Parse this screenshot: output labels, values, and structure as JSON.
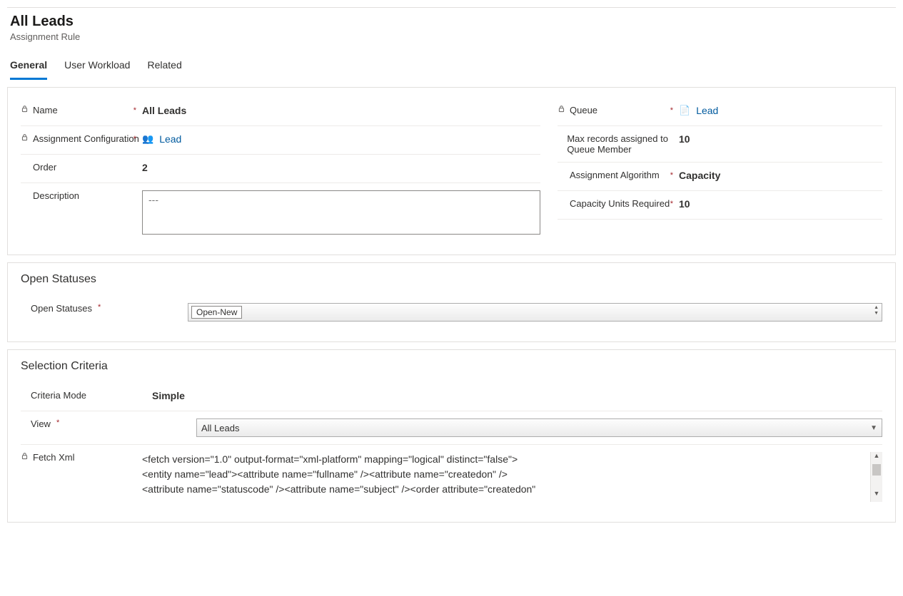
{
  "header": {
    "title": "All Leads",
    "subtitle": "Assignment Rule"
  },
  "tabs": {
    "general": "General",
    "user_workload": "User Workload",
    "related": "Related"
  },
  "left": {
    "name_label": "Name",
    "name_value": "All Leads",
    "ac_label": "Assignment Configuration",
    "ac_value": "Lead",
    "order_label": "Order",
    "order_value": "2",
    "desc_label": "Description",
    "desc_placeholder": "---"
  },
  "right": {
    "queue_label": "Queue",
    "queue_value": "Lead",
    "max_label": "Max records assigned to Queue Member",
    "max_value": "10",
    "algo_label": "Assignment Algorithm",
    "algo_value": "Capacity",
    "cap_label": "Capacity Units Required",
    "cap_value": "10"
  },
  "open_statuses": {
    "section_title": "Open Statuses",
    "label": "Open Statuses",
    "chip": "Open-New"
  },
  "selection": {
    "section_title": "Selection Criteria",
    "mode_label": "Criteria Mode",
    "mode_value": "Simple",
    "view_label": "View",
    "view_value": "All Leads",
    "fetch_label": "Fetch Xml",
    "fetch_value": "<fetch version=\"1.0\" output-format=\"xml-platform\" mapping=\"logical\" distinct=\"false\">\n<entity name=\"lead\"><attribute name=\"fullname\" /><attribute name=\"createdon\" />\n<attribute name=\"statuscode\" /><attribute name=\"subject\" /><order attribute=\"createdon\""
  }
}
